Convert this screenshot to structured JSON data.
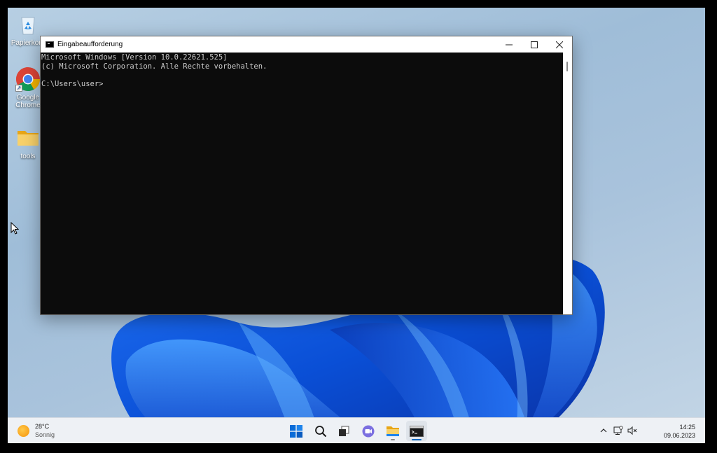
{
  "desktop": {
    "icons": [
      {
        "label": "Papierkorb",
        "icon": "recycle-bin-icon"
      },
      {
        "label": "Google Chrome",
        "icon": "chrome-icon"
      },
      {
        "label": "tools",
        "icon": "folder-icon"
      }
    ]
  },
  "window": {
    "title": "Eingabeaufforderung",
    "icon": "cmd-icon",
    "console_lines": [
      "Microsoft Windows [Version 10.0.22621.525]",
      "(c) Microsoft Corporation. Alle Rechte vorbehalten.",
      "",
      "C:\\Users\\user>"
    ],
    "controls": {
      "minimize": "minimize-icon",
      "maximize": "maximize-icon",
      "close": "close-icon"
    }
  },
  "taskbar": {
    "weather": {
      "temp": "28°C",
      "condition": "Sonnig"
    },
    "apps": [
      "start-icon",
      "search-icon",
      "task-view-icon",
      "chat-icon",
      "file-explorer-icon",
      "terminal-icon"
    ],
    "tray_icons": [
      "chevron-up-icon",
      "network-icon",
      "volume-muted-icon"
    ],
    "clock": {
      "time": "14:25",
      "date": "09.06.2023"
    }
  },
  "colors": {
    "accent": "#0067c0",
    "console_bg": "#0c0c0c",
    "console_fg": "#cccccc",
    "taskbar_bg": "#eef1f5"
  }
}
